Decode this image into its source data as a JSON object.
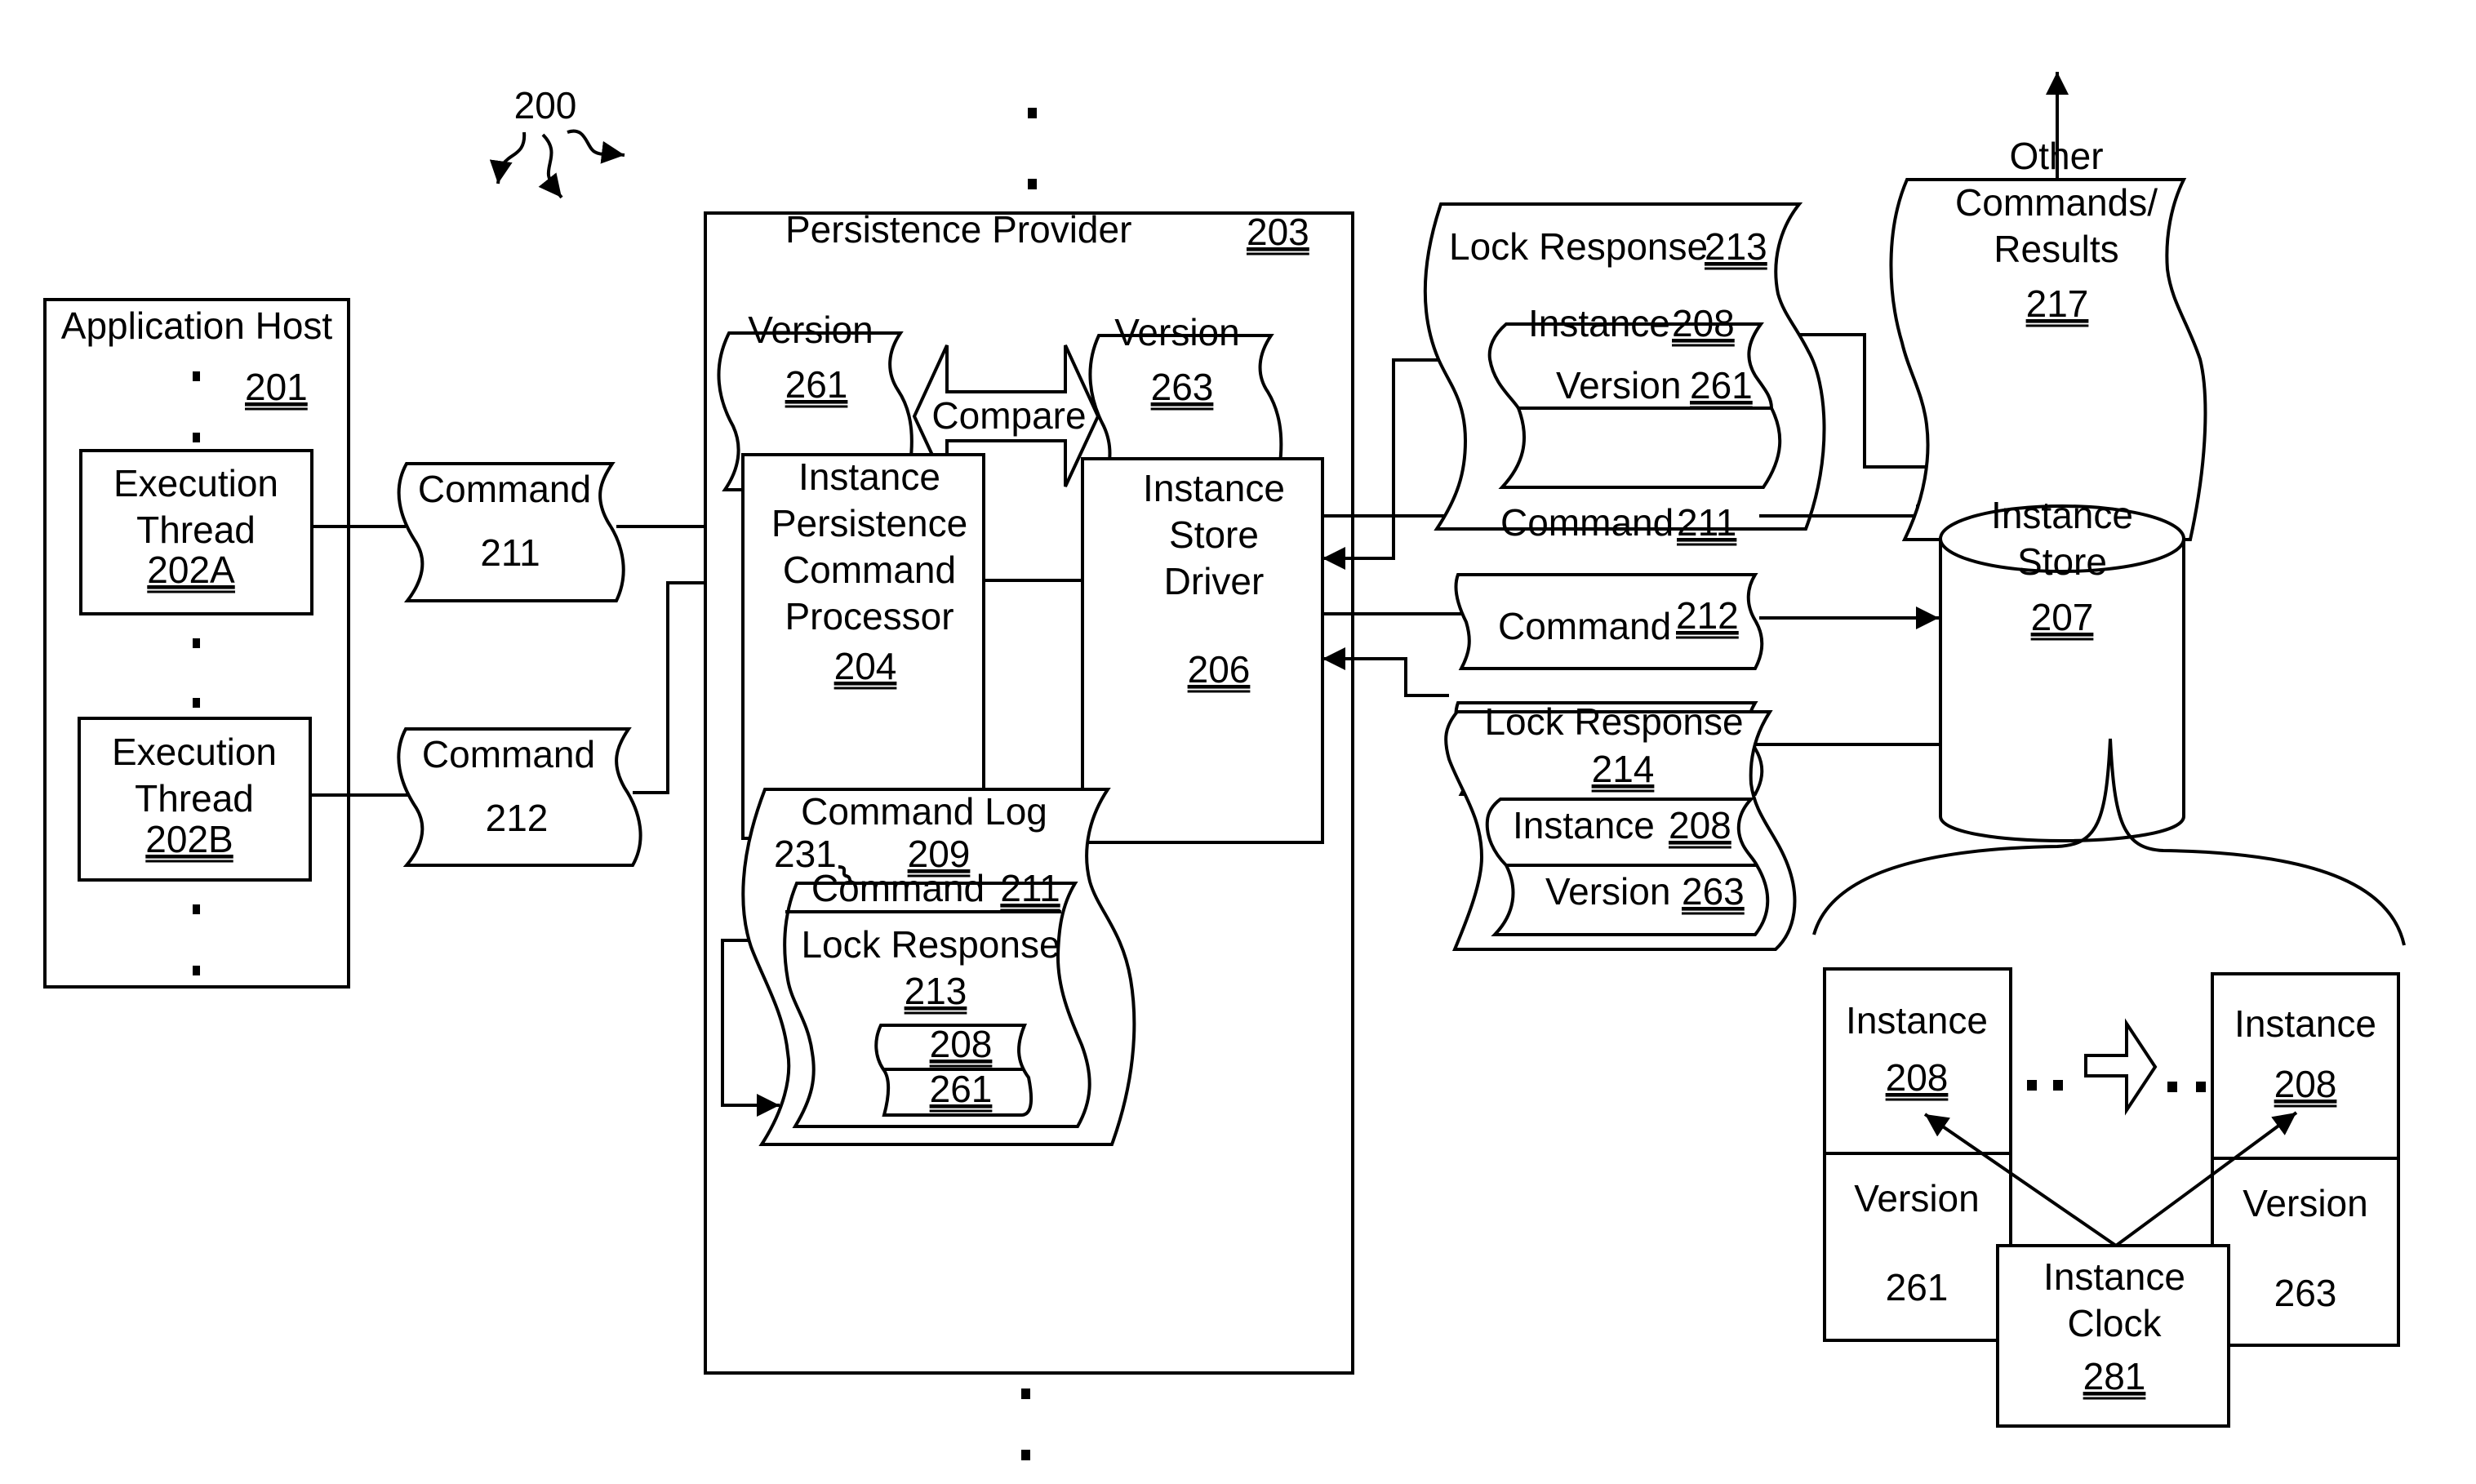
{
  "figure": {
    "ref": "200",
    "application_host": {
      "title": "Application Host",
      "ref": "201",
      "threads": [
        {
          "line1": "Execution",
          "line2": "Thread",
          "ref": "202A"
        },
        {
          "line1": "Execution",
          "line2": "Thread",
          "ref": "202B"
        }
      ]
    },
    "commands_in": [
      {
        "label": "Command",
        "ref": "211"
      },
      {
        "label": "Command",
        "ref": "212"
      }
    ],
    "persistence_provider": {
      "title": "Persistence Provider",
      "ref": "203",
      "version_left": {
        "label": "Version",
        "ref": "261"
      },
      "compare_label": "Compare",
      "version_right": {
        "label": "Version",
        "ref": "263"
      },
      "command_processor": {
        "lines": [
          "Instance",
          "Persistence",
          "Command",
          "Processor"
        ],
        "ref": "204"
      },
      "store_driver": {
        "lines": [
          "Instance",
          "Store",
          "Driver"
        ],
        "ref": "206"
      },
      "command_log": {
        "title": "Command Log",
        "ref": "209",
        "entry_ref": "231",
        "command": {
          "label": "Command",
          "ref": "211"
        },
        "lock_response": {
          "label": "Lock Response",
          "ref": "213"
        },
        "instance_ref": "208",
        "version_ref": "261"
      }
    },
    "lock_response_213": {
      "label": "Lock Response",
      "ref": "213",
      "instance": {
        "label": "Instance",
        "ref": "208"
      },
      "version": {
        "label": "Version",
        "ref": "261"
      }
    },
    "commands_out": [
      {
        "label": "Command",
        "ref": "211"
      },
      {
        "label": "Command",
        "ref": "212"
      }
    ],
    "lock_response_214": {
      "label": "Lock Response",
      "ref": "214",
      "instance": {
        "label": "Instance",
        "ref": "208"
      },
      "version": {
        "label": "Version",
        "ref": "263"
      }
    },
    "other_commands": {
      "lines": [
        "Other",
        "Commands/",
        "Results"
      ],
      "ref": "217"
    },
    "instance_store": {
      "lines": [
        "Instance",
        "Store"
      ],
      "ref": "207"
    },
    "instance_states": [
      {
        "instance_label": "Instance",
        "instance_ref": "208",
        "version_label": "Version",
        "version_value": "261"
      },
      {
        "instance_label": "Instance",
        "instance_ref": "208",
        "version_label": "Version",
        "version_value": "263"
      }
    ],
    "instance_clock": {
      "lines": [
        "Instance",
        "Clock"
      ],
      "ref": "281"
    }
  }
}
